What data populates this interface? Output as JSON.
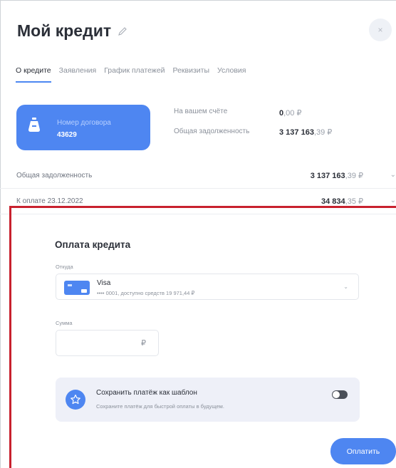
{
  "header": {
    "title": "Мой кредит",
    "close_label": "×"
  },
  "tabs": [
    {
      "label": "О кредите",
      "active": true
    },
    {
      "label": "Заявления",
      "active": false
    },
    {
      "label": "График платежей",
      "active": false
    },
    {
      "label": "Реквизиты",
      "active": false
    },
    {
      "label": "Условия",
      "active": false
    }
  ],
  "contract_card": {
    "label": "Номер договора",
    "number": "43629"
  },
  "account_info": {
    "balance_label": "На вашем счёте",
    "balance_main": "0",
    "balance_kop": ",00 ₽",
    "debt_label": "Общая задолженность",
    "debt_main": "3 137 163",
    "debt_kop": ",39 ₽"
  },
  "summary_rows": [
    {
      "label": "Общая задолженность",
      "value_main": "3 137 163",
      "value_kop": ",39 ₽",
      "chevron": "⌄"
    },
    {
      "label": "К оплате 23.12.2022",
      "value_main": "34 834",
      "value_kop": ",35 ₽",
      "chevron": "⌄"
    }
  ],
  "payment": {
    "title": "Оплата кредита",
    "source_label": "Откуда",
    "source_name": "Visa",
    "source_sub": "•••• 0001, доступно средств 19 971,44 ₽",
    "select_chevron": "⌄",
    "amount_label": "Сумма",
    "amount_currency": "₽",
    "template_title": "Сохранить платёж как шаблон",
    "template_sub": "Сохраните платёж для быстрой оплаты в будущем.",
    "template_toggle_on": false,
    "pay_button": "Оплатить"
  },
  "colors": {
    "accent": "#4e86f1",
    "highlight_border": "#c8212e"
  }
}
